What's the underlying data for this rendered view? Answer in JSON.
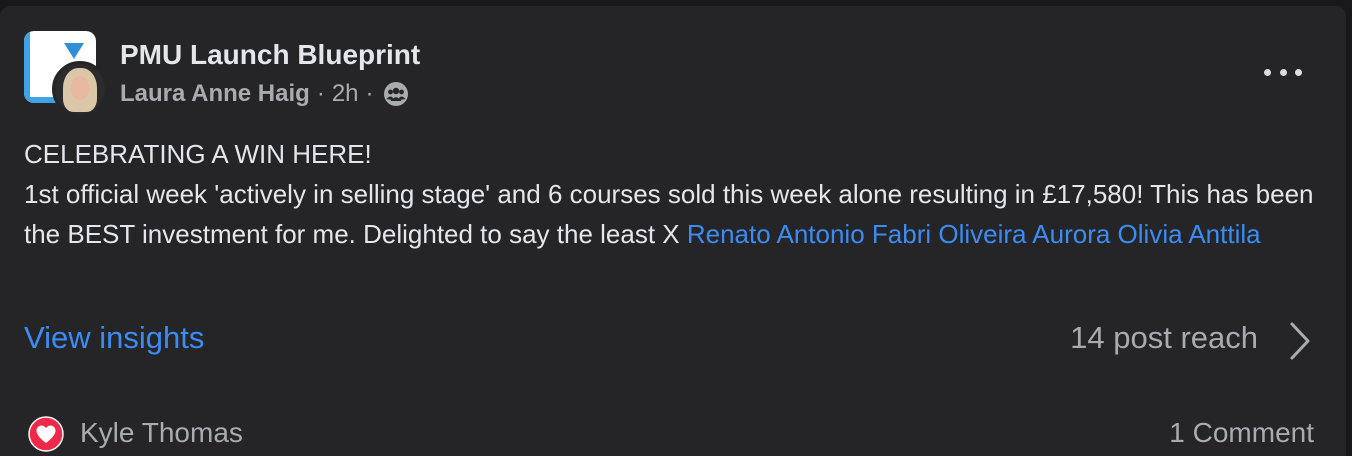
{
  "post": {
    "group_name": "PMU Launch Blueprint",
    "author": "Laura Anne Haig",
    "separator": "·",
    "time": "2h",
    "privacy_icon": "group-icon",
    "more_icon": "more-dots-icon",
    "body_line1": "CELEBRATING A WIN HERE!",
    "body_line2": "1st official week 'actively in selling stage' and 6 courses sold this week alone resulting in £17,580! This has been the BEST investment for me. Delighted to say the least X ",
    "mentions": [
      "Renato Antonio Fabri Oliveira",
      "Aurora Olivia Anttila"
    ]
  },
  "insights": {
    "link_label": "View insights",
    "reach": "14 post reach",
    "chevron_icon": "chevron-right-icon"
  },
  "footer": {
    "reaction_icon": "heart-reaction-icon",
    "reactor_name": "Kyle Thomas",
    "comment_count": "1 Comment"
  },
  "colors": {
    "background": "#18181a",
    "card": "#252528",
    "link": "#3b8cf2",
    "secondary_text": "#a8abaf",
    "heart": "#f0284a"
  }
}
